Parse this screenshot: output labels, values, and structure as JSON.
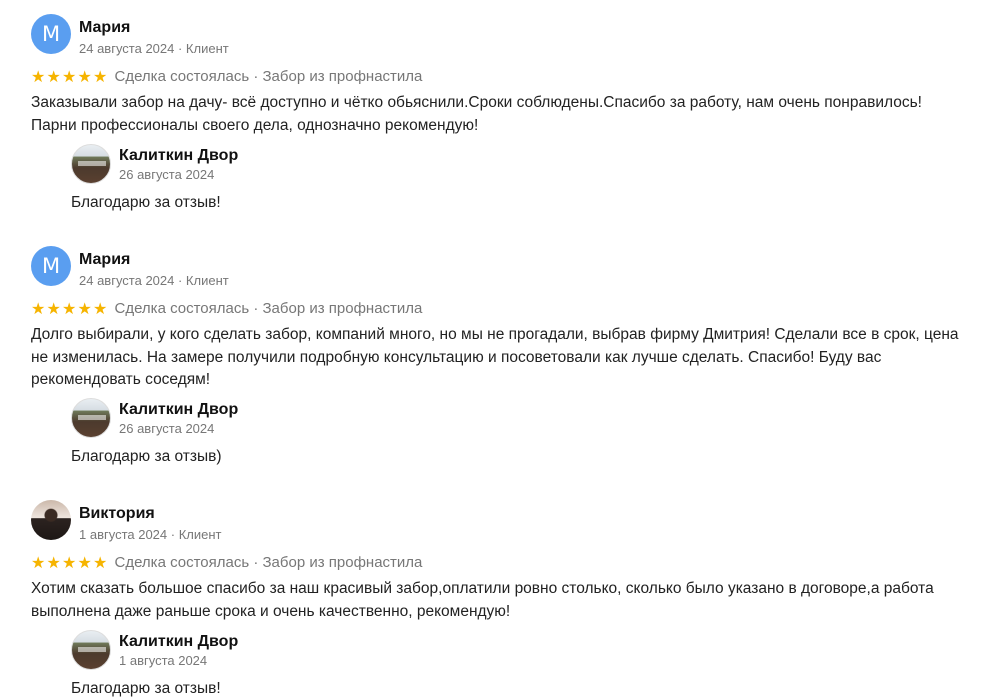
{
  "reviews": [
    {
      "author": "Мария",
      "avatar_letter": "М",
      "meta": "24 августа 2024 · Клиент",
      "stars": 5,
      "deal": "Сделка состоялась · Забор из профнастила",
      "text_lines": [
        "Заказывали забор на дачу- всё доступно и чётко обьяснили.Сроки соблюдены.Спасибо за работу, нам очень понравилось!",
        "Парни профессионалы своего дела, однозначно рекомендую!"
      ],
      "reply": {
        "author": "Калиткин Двор",
        "date": "26 августа 2024",
        "text": "Благодарю за отзыв!"
      }
    },
    {
      "author": "Мария",
      "avatar_letter": "М",
      "meta": "24 августа 2024 · Клиент",
      "stars": 5,
      "deal": "Сделка состоялась · Забор из профнастила",
      "text_lines": [
        "Долго выбирали, у кого сделать забор, компаний много, но мы не прогадали, выбрав фирму Дмитрия! Сделали все в срок, цена",
        "не изменилась. На замере получили подробную консультацию и посоветовали как лучше сделать. Спасибо! Буду вас",
        "рекомендовать соседям!"
      ],
      "reply": {
        "author": "Калиткин Двор",
        "date": "26 августа 2024",
        "text": "Благодарю за отзыв)"
      }
    },
    {
      "author": "Виктория",
      "avatar_letter": "",
      "meta": "1 августа 2024 · Клиент",
      "stars": 5,
      "deal": "Сделка состоялась · Забор из профнастила",
      "text_lines": [
        "Хотим сказать большое спасибо за наш красивый забор,оплатили ровно столько, сколько было указано в договоре,а работа",
        "выполнена даже раньше срока и очень качественно, рекомендую!"
      ],
      "reply": {
        "author": "Калиткин Двор",
        "date": "1 августа 2024",
        "text": "Благодарю за отзыв!"
      }
    }
  ],
  "star_color": "#f6b400",
  "avatar_color": "#5a9ef0"
}
